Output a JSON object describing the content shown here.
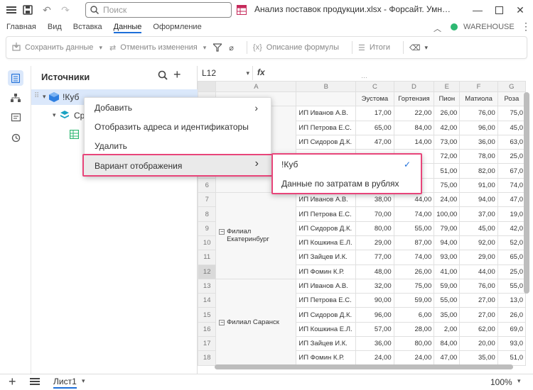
{
  "titlebar": {
    "search_placeholder": "Поиск",
    "doc_title": "Анализ поставок продукции.xlsx - Форсайт. Умн…"
  },
  "menubar": {
    "items": [
      "Главная",
      "Вид",
      "Вставка",
      "Данные",
      "Оформление"
    ],
    "active": "Данные",
    "warehouse_label": "WAREHOUSE",
    "status_color": "#2eb872"
  },
  "toolbar": {
    "save_label": "Сохранить данные",
    "undo_label": "Отменить изменения",
    "formula_label": "Описание формулы",
    "totals_label": "Итоги"
  },
  "panel": {
    "title": "Источники",
    "cube_label": "!Куб",
    "sr_label": "Ср"
  },
  "context_menu": {
    "items": [
      "Добавить",
      "Отобразить адреса и идентификаторы",
      "Удалить",
      "Вариант отображения"
    ]
  },
  "submenu": {
    "items": [
      "!Куб",
      "Данные по затратам в рублях"
    ]
  },
  "formula_bar": {
    "cell_ref": "L12",
    "fx": "fx"
  },
  "sheet": {
    "col_letters": [
      "A",
      "B",
      "C",
      "D",
      "E",
      "F",
      "G"
    ],
    "headers": [
      "Эустома",
      "Гортензия",
      "Пион",
      "Матиола",
      "Роза"
    ],
    "groups": [
      "Филиал Екатеринбург",
      "Филиал Саранск"
    ],
    "rows": [
      {
        "n": "",
        "name": "",
        "v": [
          "",
          "",
          "",
          "",
          ""
        ]
      },
      {
        "n": "",
        "name": "ИП Иванов А.В.",
        "v": [
          "17,00",
          "22,00",
          "26,00",
          "76,00",
          "75,0"
        ]
      },
      {
        "n": "",
        "name": "ИП Петрова Е.С.",
        "v": [
          "65,00",
          "84,00",
          "42,00",
          "96,00",
          "45,0"
        ]
      },
      {
        "n": "",
        "name": "ИП Сидоров Д.К.",
        "v": [
          "47,00",
          "14,00",
          "73,00",
          "36,00",
          "63,0"
        ]
      },
      {
        "n": "",
        "name": "",
        "v": [
          "",
          "",
          "72,00",
          "78,00",
          "25,0"
        ]
      },
      {
        "n": "",
        "name": "",
        "v": [
          "",
          "",
          "51,00",
          "82,00",
          "67,0"
        ]
      },
      {
        "n": "6",
        "name": "",
        "v": [
          "",
          "",
          "75,00",
          "91,00",
          "74,0"
        ]
      },
      {
        "n": "7",
        "name": "ИП Иванов А.В.",
        "v": [
          "38,00",
          "44,00",
          "24,00",
          "94,00",
          "47,0"
        ]
      },
      {
        "n": "8",
        "name": "ИП Петрова Е.С.",
        "v": [
          "70,00",
          "74,00",
          "100,00",
          "37,00",
          "19,0"
        ]
      },
      {
        "n": "9",
        "name": "ИП Сидоров Д.К.",
        "v": [
          "80,00",
          "55,00",
          "79,00",
          "45,00",
          "42,0"
        ]
      },
      {
        "n": "10",
        "name": "ИП Кошкина Е.Л.",
        "v": [
          "29,00",
          "87,00",
          "94,00",
          "92,00",
          "52,0"
        ]
      },
      {
        "n": "11",
        "name": "ИП Зайцев И.К.",
        "v": [
          "77,00",
          "74,00",
          "93,00",
          "29,00",
          "65,0"
        ]
      },
      {
        "n": "12",
        "name": "ИП Фомин К.Р.",
        "v": [
          "48,00",
          "26,00",
          "41,00",
          "44,00",
          "25,0"
        ]
      },
      {
        "n": "13",
        "name": "ИП Иванов А.В.",
        "v": [
          "32,00",
          "75,00",
          "59,00",
          "76,00",
          "55,0"
        ]
      },
      {
        "n": "14",
        "name": "ИП Петрова Е.С.",
        "v": [
          "90,00",
          "59,00",
          "55,00",
          "27,00",
          "13,0"
        ]
      },
      {
        "n": "15",
        "name": "ИП Сидоров Д.К.",
        "v": [
          "96,00",
          "6,00",
          "35,00",
          "27,00",
          "26,0"
        ]
      },
      {
        "n": "16",
        "name": "ИП Кошкина Е.Л.",
        "v": [
          "57,00",
          "28,00",
          "2,00",
          "62,00",
          "69,0"
        ]
      },
      {
        "n": "17",
        "name": "ИП Зайцев И.К.",
        "v": [
          "36,00",
          "80,00",
          "84,00",
          "20,00",
          "93,0"
        ]
      },
      {
        "n": "18",
        "name": "ИП Фомин К.Р.",
        "v": [
          "24,00",
          "24,00",
          "47,00",
          "35,00",
          "",
          "51,0"
        ]
      }
    ]
  },
  "bottom": {
    "sheet_tab": "Лист1",
    "zoom": "100%"
  }
}
